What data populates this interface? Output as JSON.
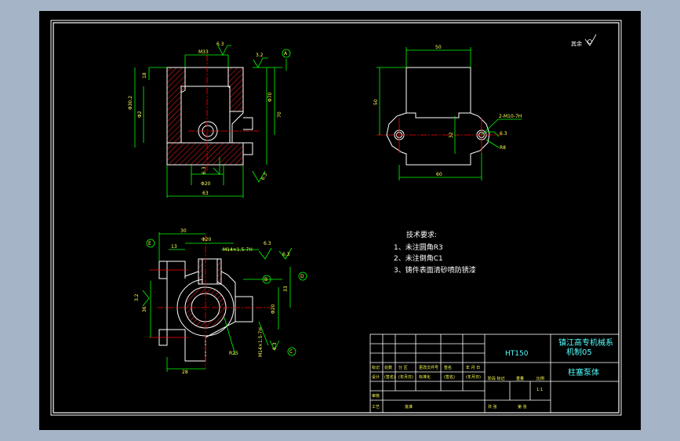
{
  "title_block": {
    "material": "HT150",
    "school_line1": "镇江高专机械系",
    "school_line2": "机制05",
    "part_name": "柱塞泵体",
    "row_labels": [
      "标记",
      "处数",
      "分 区",
      "更改文件号",
      "签名",
      "年 月 日"
    ],
    "row2_labels": [
      "设计",
      "(签名)",
      "(年月日)",
      "标准化",
      "(签名)",
      "(年月日)"
    ],
    "stage_labels": [
      "阶段 标记",
      "重量",
      "比例"
    ],
    "misc_labels": [
      "审核",
      "工艺",
      "批准"
    ],
    "sheet_info": [
      "共 张",
      "第 张"
    ],
    "scale": "1:1"
  },
  "notes": {
    "heading": "技术要求:",
    "items": [
      "1、未注圆角R3",
      "2、未注倒角C1",
      "3、铸件表面清砂喷防锈漆"
    ]
  },
  "surface_finish": {
    "rest_label": "其余"
  },
  "dimensions": {
    "front": [
      "6.3",
      "M33",
      "3.2",
      "A",
      "18",
      "Φ30.2",
      "Φ2",
      "Φ70",
      "70",
      "6.3",
      "Φ20",
      "63",
      "6.3"
    ],
    "side": [
      "50",
      "50",
      "32",
      "60",
      "2-M10-7H",
      "6.3",
      "R8"
    ],
    "top": [
      "30",
      "Φ20",
      "M14×1.5-7H",
      "6.3",
      "E",
      "13",
      "6.3",
      "D",
      "B",
      "33",
      "3.2",
      "36",
      "Φ20",
      "M14×1.5-7H",
      "R25",
      "28",
      "6.3",
      "C"
    ]
  },
  "colors": {
    "outline": "#ffffff",
    "dimension": "#00ff00",
    "centerline": "#ff0000",
    "hatch": "#ff0000",
    "text_block": "#55ffff",
    "sheet": "#000000"
  }
}
